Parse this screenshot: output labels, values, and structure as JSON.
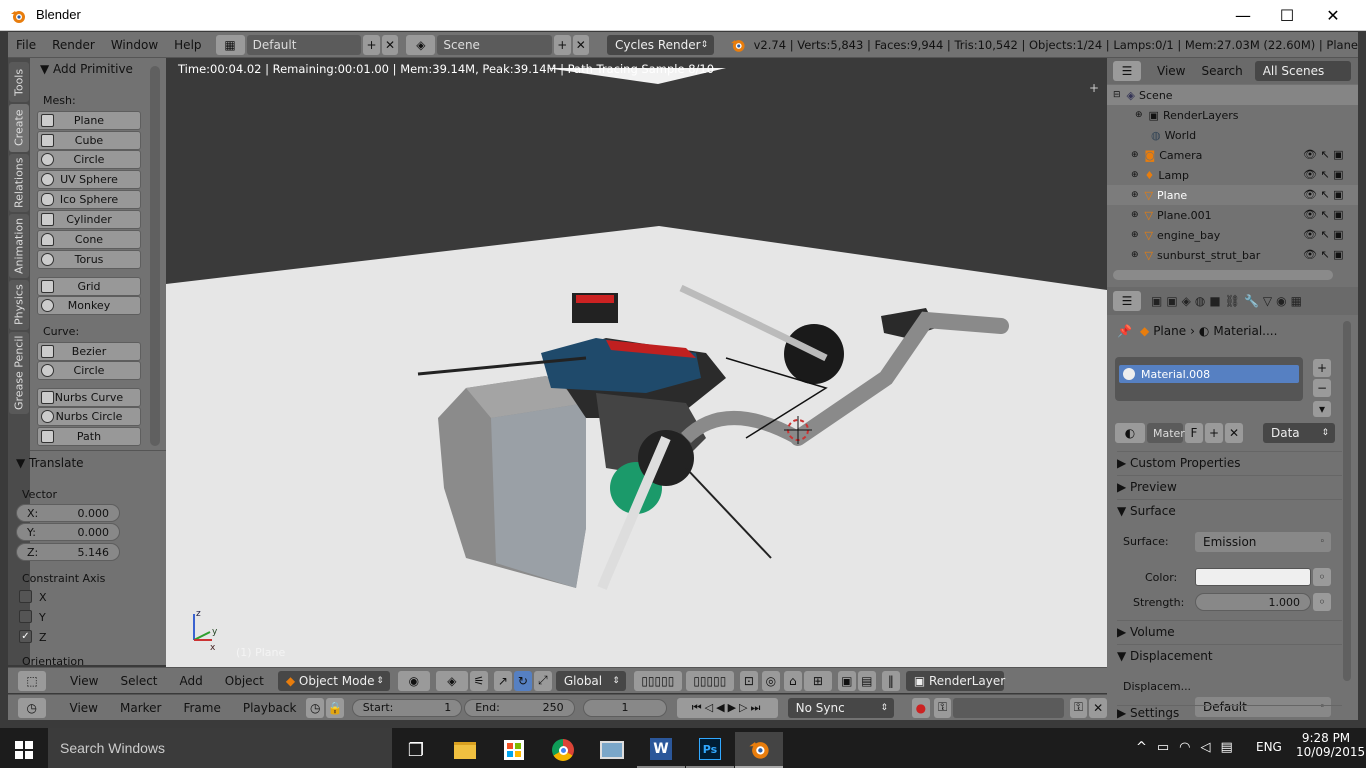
{
  "window": {
    "title": "Blender",
    "minimize": "—",
    "maximize": "☐",
    "close": "✕"
  },
  "info_header": {
    "menus": [
      "File",
      "Render",
      "Window",
      "Help"
    ],
    "screen_layout": "Default",
    "scene": "Scene",
    "render_engine": "Cycles Render",
    "stats": "v2.74 | Verts:5,843 | Faces:9,944 | Tris:10,542 | Objects:1/24 | Lamps:0/1 | Mem:27.03M (22.60M) | Plane"
  },
  "tool_tabs": [
    "Tools",
    "Create",
    "Relations",
    "Animation",
    "Physics",
    "Grease Pencil"
  ],
  "add_primitive": {
    "title": "Add Primitive",
    "mesh_label": "Mesh:",
    "mesh": [
      "Plane",
      "Cube",
      "Circle",
      "UV Sphere",
      "Ico Sphere",
      "Cylinder",
      "Cone",
      "Torus"
    ],
    "mesh2": [
      "Grid",
      "Monkey"
    ],
    "curve_label": "Curve:",
    "curve": [
      "Bezier",
      "Circle"
    ],
    "nurbs": [
      "Nurbs Curve",
      "Nurbs Circle",
      "Path"
    ]
  },
  "translate": {
    "title": "Translate",
    "vector_label": "Vector",
    "x_label": "X:",
    "x": "0.000",
    "y_label": "Y:",
    "y": "0.000",
    "z_label": "Z:",
    "z": "5.146",
    "constraint_label": "Constraint Axis",
    "axes": [
      "X",
      "Y",
      "Z"
    ],
    "axes_checked": [
      false,
      false,
      true
    ],
    "orientation_label": "Orientation"
  },
  "viewport": {
    "render_info": "Time:00:04.02 | Remaining:00:01.00 | Mem:39.14M, Peak:39.14M | Path Tracing Sample 8/10",
    "object_label": "(1) Plane"
  },
  "view3d_header": {
    "menus": [
      "View",
      "Select",
      "Add",
      "Object"
    ],
    "mode": "Object Mode",
    "orientation": "Global",
    "render_layer": "RenderLayer"
  },
  "timeline_header": {
    "menus": [
      "View",
      "Marker",
      "Frame",
      "Playback"
    ],
    "start_label": "Start:",
    "start": "1",
    "end_label": "End:",
    "end": "250",
    "current": "1",
    "sync": "No Sync"
  },
  "outliner": {
    "menus": [
      "View",
      "Search"
    ],
    "filter": "All Scenes",
    "items": [
      "Scene",
      "RenderLayers",
      "World",
      "Camera",
      "Lamp",
      "Plane",
      "Plane.001",
      "engine_bay",
      "sunburst_strut_bar"
    ]
  },
  "properties": {
    "breadcrumb_object": "Plane",
    "breadcrumb_material": "Material....",
    "material_slot": "Material.008",
    "material_name": "Materi",
    "fake_user": "F",
    "data_link": "Data",
    "sections": [
      "Custom Properties",
      "Preview",
      "Surface",
      "Volume",
      "Displacement",
      "Settings"
    ],
    "surface_label": "Surface:",
    "surface_value": "Emission",
    "color_label": "Color:",
    "strength_label": "Strength:",
    "strength_value": "1.000",
    "displacement_label": "Displacem...",
    "displacement_value": "Default"
  },
  "taskbar": {
    "search_placeholder": "Search Windows",
    "language": "ENG",
    "time": "9:28 PM",
    "date": "10/09/2015"
  },
  "colors": {
    "blender_orange": "#e87d0d",
    "selection_blue": "#5680c2",
    "panel_gray": "#727272",
    "viewport_floor": "#e6e6e6"
  }
}
